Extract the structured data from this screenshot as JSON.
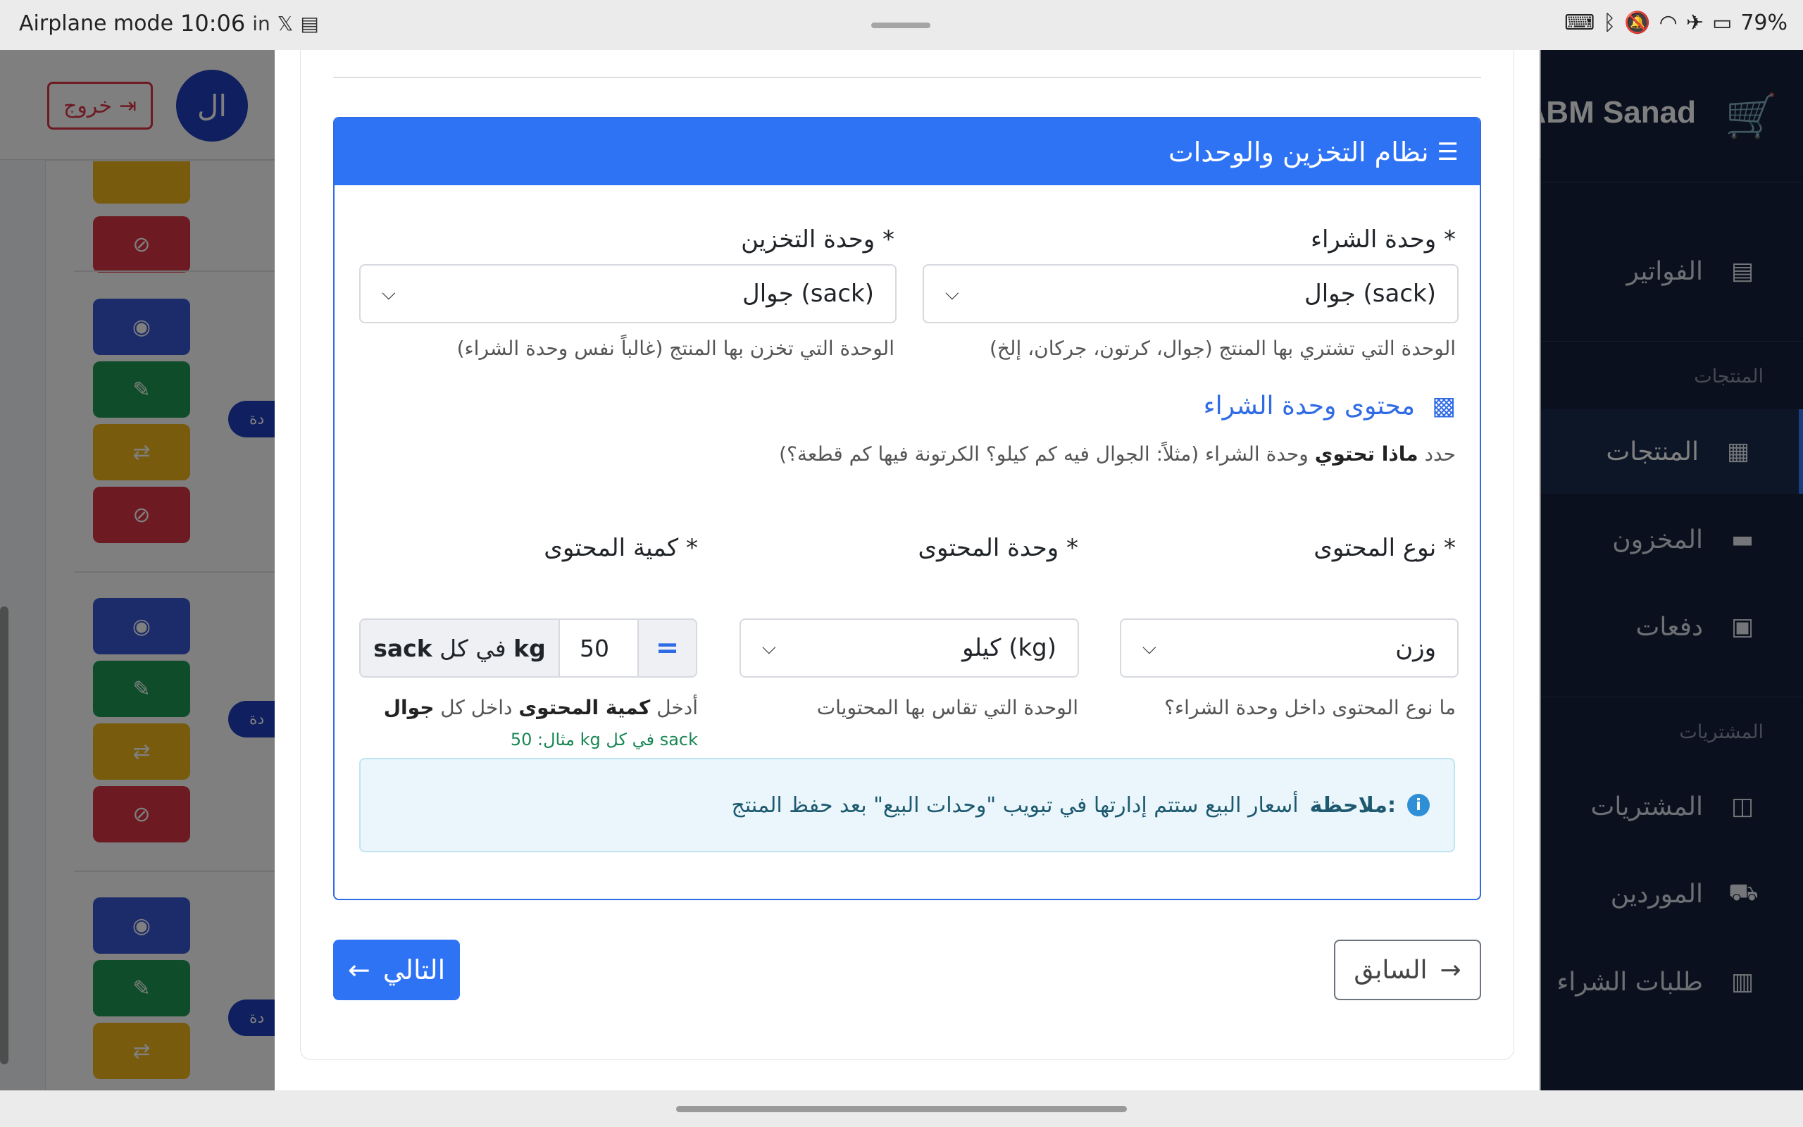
{
  "status_bar": {
    "mode": "Airplane mode",
    "time": "10:06",
    "battery": "79%",
    "left_icons": [
      "linkedin-icon",
      "x-icon",
      "pdf-icon"
    ],
    "right_icons": [
      "keyboard-icon",
      "bluetooth-battery-icon",
      "mute-icon",
      "wifi-icon",
      "airplane-icon",
      "battery-icon"
    ]
  },
  "background": {
    "logout_label": "خروج",
    "avatar_initials": "ال",
    "unit_chip_label": "دة"
  },
  "sidebar": {
    "brand": "ABM Sanad",
    "items": [
      {
        "label": "الفواتير",
        "icon": "invoice-icon"
      },
      {
        "label": "المنتجات",
        "icon": "products-icon"
      },
      {
        "label": "المخزون",
        "icon": "warehouse-icon"
      },
      {
        "label": "دفعات",
        "icon": "batches-icon"
      },
      {
        "label": "المشتريات",
        "icon": "basket-icon"
      },
      {
        "label": "الموردين",
        "icon": "supplier-truck-icon"
      },
      {
        "label": "طلبات الشراء",
        "icon": "clipboard-icon"
      }
    ],
    "sections": [
      "المنتجات",
      "المشتريات"
    ]
  },
  "storage": {
    "title": "نظام التخزين والوحدات",
    "purchase_unit": {
      "label": "وحدة الشراء *",
      "value": "جوال (sack)",
      "help": "الوحدة التي تشتري بها المنتج (جوال، كرتون، جركان، إلخ)"
    },
    "storage_unit": {
      "label": "وحدة التخزين *",
      "value": "جوال (sack)",
      "help": "الوحدة التي تخزن بها المنتج (غالباً نفس وحدة الشراء)"
    },
    "content_section": {
      "title": "محتوى وحدة الشراء",
      "desc_before": "حدد",
      "desc_bold": "ماذا تحتوي",
      "desc_after": "وحدة الشراء (مثلاً: الجوال فيه كم كيلو؟ الكرتونة فيها كم قطعة؟)"
    },
    "content_type": {
      "label": "نوع المحتوى *",
      "value": "وزن",
      "help": "ما نوع المحتوى داخل وحدة الشراء؟"
    },
    "content_unit": {
      "label": "وحدة المحتوى *",
      "value": "كيلو (kg)",
      "help": "الوحدة التي تقاس بها المحتويات"
    },
    "content_qty": {
      "label": "كمية المحتوى *",
      "value": "50",
      "equals": "=",
      "addon_unit": "kg",
      "addon_mid": "في كل",
      "addon_pack": "sack",
      "help_before": "أدخل",
      "help_bold": "كمية المحتوى",
      "help_after": "داخل كل",
      "help_bold2": "جوال",
      "example": "مثال: 50 kg في كل sack"
    },
    "note": {
      "bold": "ملاحظة:",
      "text": "أسعار البيع ستتم إدارتها في تبويب \"وحدات البيع\" بعد حفظ المنتج"
    }
  },
  "footer": {
    "next_label": "التالي",
    "prev_label": "السابق"
  },
  "colors": {
    "primary": "#2f73f5",
    "sidebar_bg": "#14213a",
    "danger": "#dc3545",
    "success": "#1f9a55",
    "warning": "#f0b619",
    "info_bg": "#eaf6fb"
  }
}
